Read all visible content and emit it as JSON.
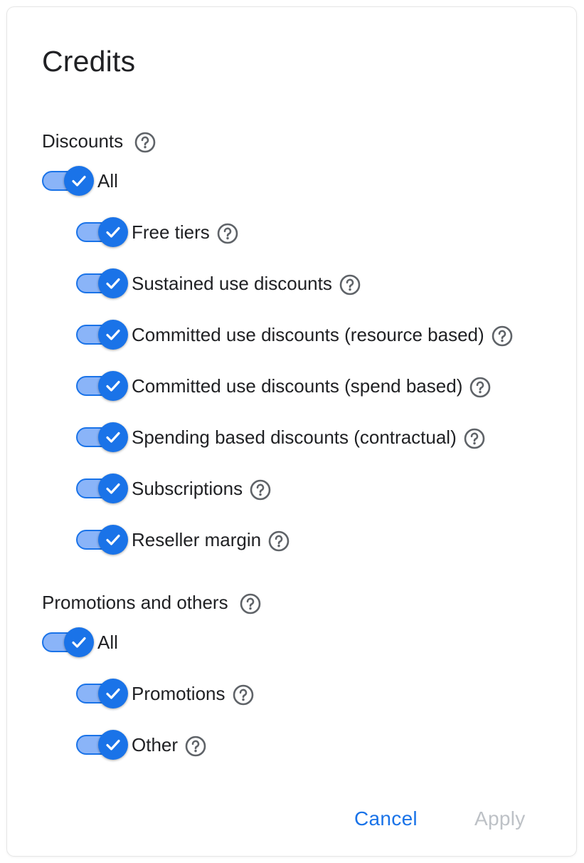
{
  "dialog": {
    "title": "Credits"
  },
  "sections": [
    {
      "heading": "Discounts",
      "all_label": "All",
      "all_checked": true,
      "items": [
        {
          "label": "Free tiers",
          "checked": true
        },
        {
          "label": "Sustained use discounts",
          "checked": true
        },
        {
          "label": "Committed use discounts (resource based)",
          "checked": true
        },
        {
          "label": "Committed use discounts (spend based)",
          "checked": true
        },
        {
          "label": "Spending based discounts (contractual)",
          "checked": true
        },
        {
          "label": "Subscriptions",
          "checked": true
        },
        {
          "label": "Reseller margin",
          "checked": true
        }
      ]
    },
    {
      "heading": "Promotions and others",
      "all_label": "All",
      "all_checked": true,
      "items": [
        {
          "label": "Promotions",
          "checked": true
        },
        {
          "label": "Other",
          "checked": true
        }
      ]
    }
  ],
  "actions": {
    "cancel_label": "Cancel",
    "apply_label": "Apply",
    "apply_enabled": false
  },
  "icons": {
    "help": "help-circle-icon",
    "check": "check-icon"
  },
  "colors": {
    "accent": "#1a73e8",
    "toggle_track": "#8ab4f8",
    "text": "#202124",
    "disabled": "#bdc1c6",
    "help_icon": "#5f6368"
  }
}
